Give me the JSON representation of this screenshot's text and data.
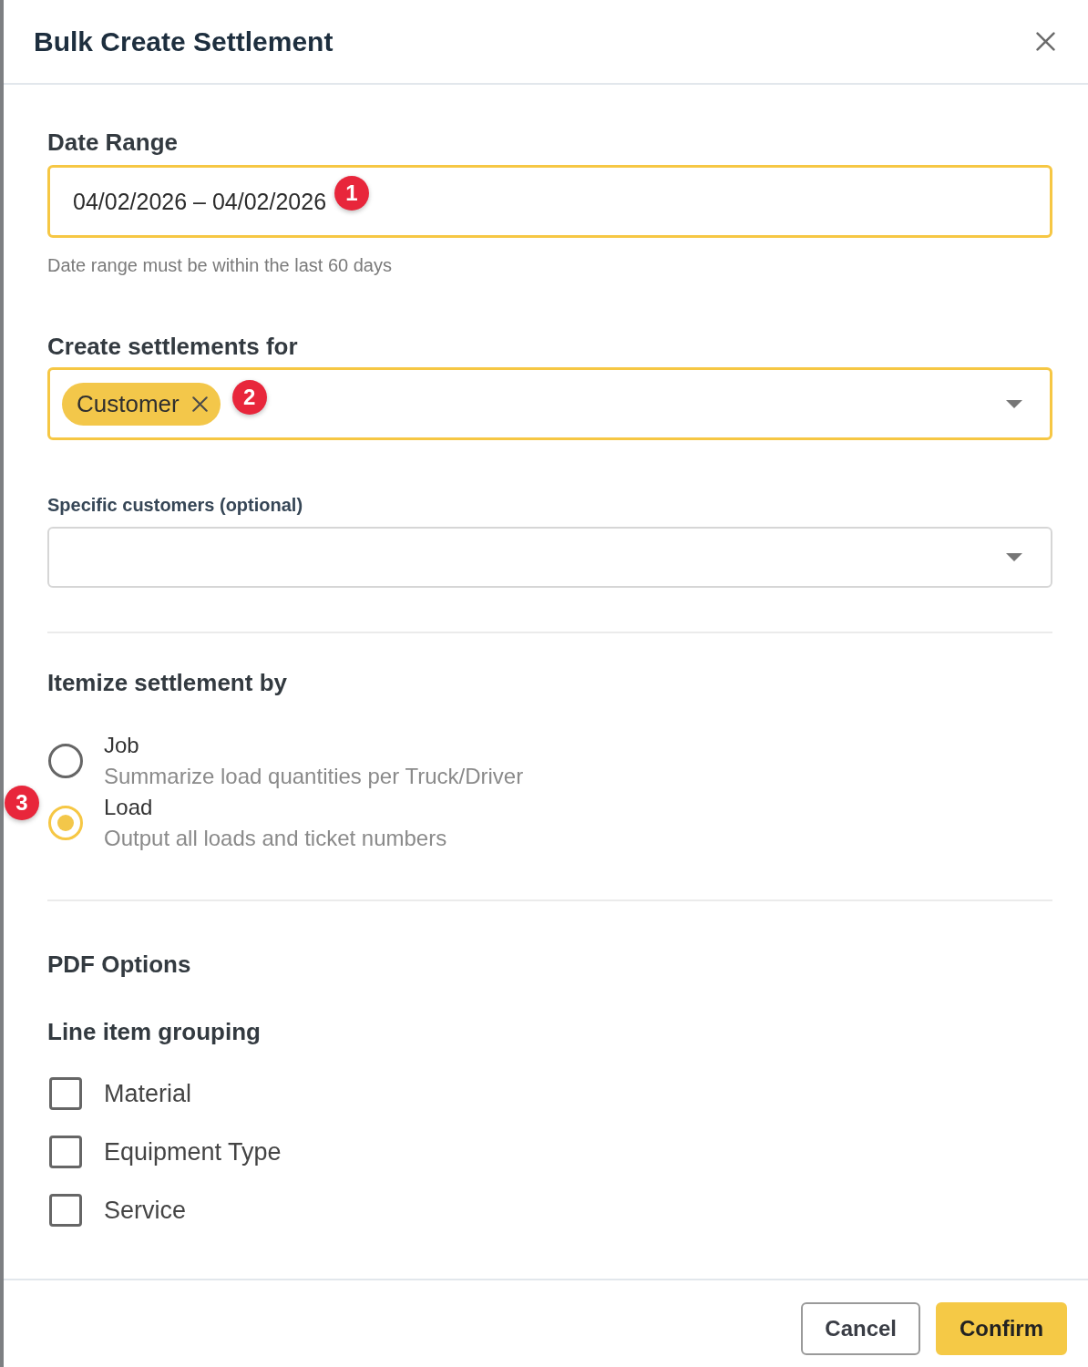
{
  "dialog": {
    "title": "Bulk Create Settlement"
  },
  "date_range": {
    "label": "Date Range",
    "value": "04/02/2026 – 04/02/2026",
    "highlighted": true,
    "marker": "1",
    "hint": "Date range must be within the last 60 days"
  },
  "create_for": {
    "label": "Create settlements for",
    "chips": [
      {
        "label": "Customer"
      }
    ],
    "highlighted": true,
    "marker": "2"
  },
  "specific_customers": {
    "label": "Specific customers (optional)",
    "highlighted": false
  },
  "itemize": {
    "title": "Itemize settlement by",
    "marker": "3",
    "options": [
      {
        "label": "Job",
        "description": "Summarize load quantities per Truck/Driver",
        "selected": false
      },
      {
        "label": "Load",
        "description": "Output all loads and ticket numbers",
        "selected": true
      }
    ]
  },
  "pdf_options": {
    "title": "PDF Options",
    "subtitle": "Line item grouping",
    "options": [
      {
        "label": "Material",
        "checked": false
      },
      {
        "label": "Equipment Type",
        "checked": false
      },
      {
        "label": "Service",
        "checked": false
      }
    ]
  },
  "buttons": [
    {
      "label": "Cancel",
      "kind": "secondary"
    },
    {
      "label": "Confirm",
      "kind": "primary"
    }
  ]
}
